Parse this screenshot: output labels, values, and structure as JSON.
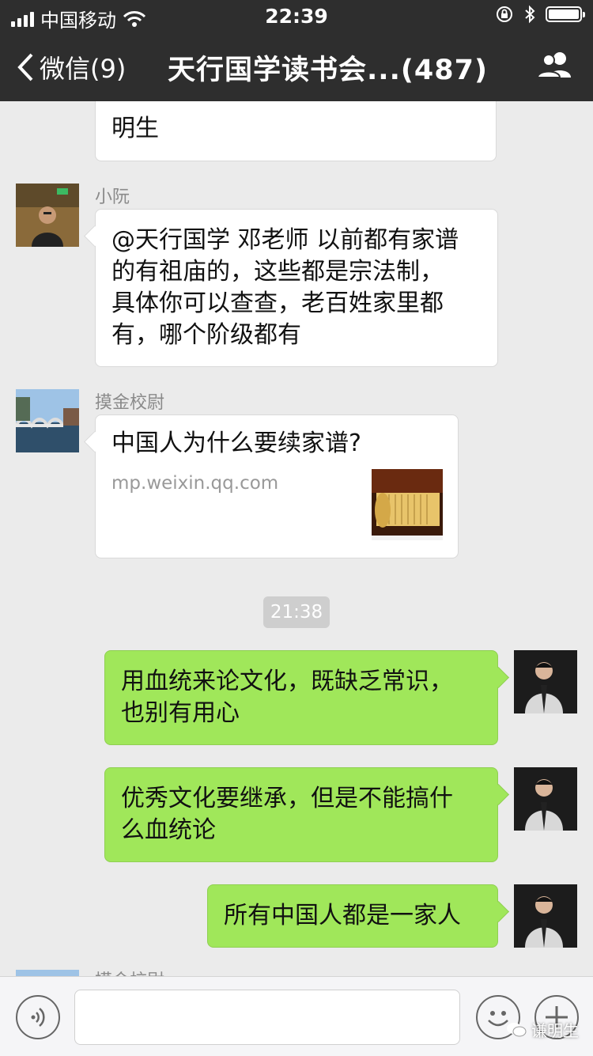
{
  "status_bar": {
    "carrier": "中国移动",
    "time": "22:39",
    "signal_bars": 4,
    "battery_level": 1.0
  },
  "nav": {
    "back_label": "微信(9)",
    "title": "天行国学读书会...(487)"
  },
  "messages": {
    "m0": {
      "text": "数民族是汉族人才对？@息州 谦明生",
      "visible_text": "明生"
    },
    "m1": {
      "sender": "小阮",
      "lines": [
        "@天行国学 邓老师 以前都有家谱",
        "的有祖庙的，这些都是宗法制，",
        "具体你可以查查，老百姓家里都",
        "有，哪个阶级都有"
      ]
    },
    "m2": {
      "sender": "摸金校尉",
      "card_title": "中国人为什么要续家谱?",
      "card_url": "mp.weixin.qq.com"
    },
    "timestamp": "21:38",
    "m3": {
      "lines": [
        "用血统来论文化，既缺乏常识，",
        "也别有用心"
      ]
    },
    "m4": {
      "lines": [
        "优秀文化要继承，但是不能搞什",
        "么血统论"
      ]
    },
    "m5": {
      "lines": [
        "所有中国人都是一家人"
      ]
    },
    "m6": {
      "sender": "摸金校尉"
    }
  },
  "input_bar": {
    "watermark": "谦明生"
  },
  "colors": {
    "bar_bg": "#2e2e2e",
    "chat_bg": "#ebebeb",
    "my_bubble": "#a0e75a",
    "their_bubble": "#ffffff"
  },
  "icons": [
    "wifi-icon",
    "lock-rotation-icon",
    "bluetooth-icon",
    "battery-icon",
    "back-chevron-icon",
    "group-contacts-icon",
    "voice-icon",
    "emoji-icon",
    "plus-icon",
    "wechat-icon"
  ]
}
